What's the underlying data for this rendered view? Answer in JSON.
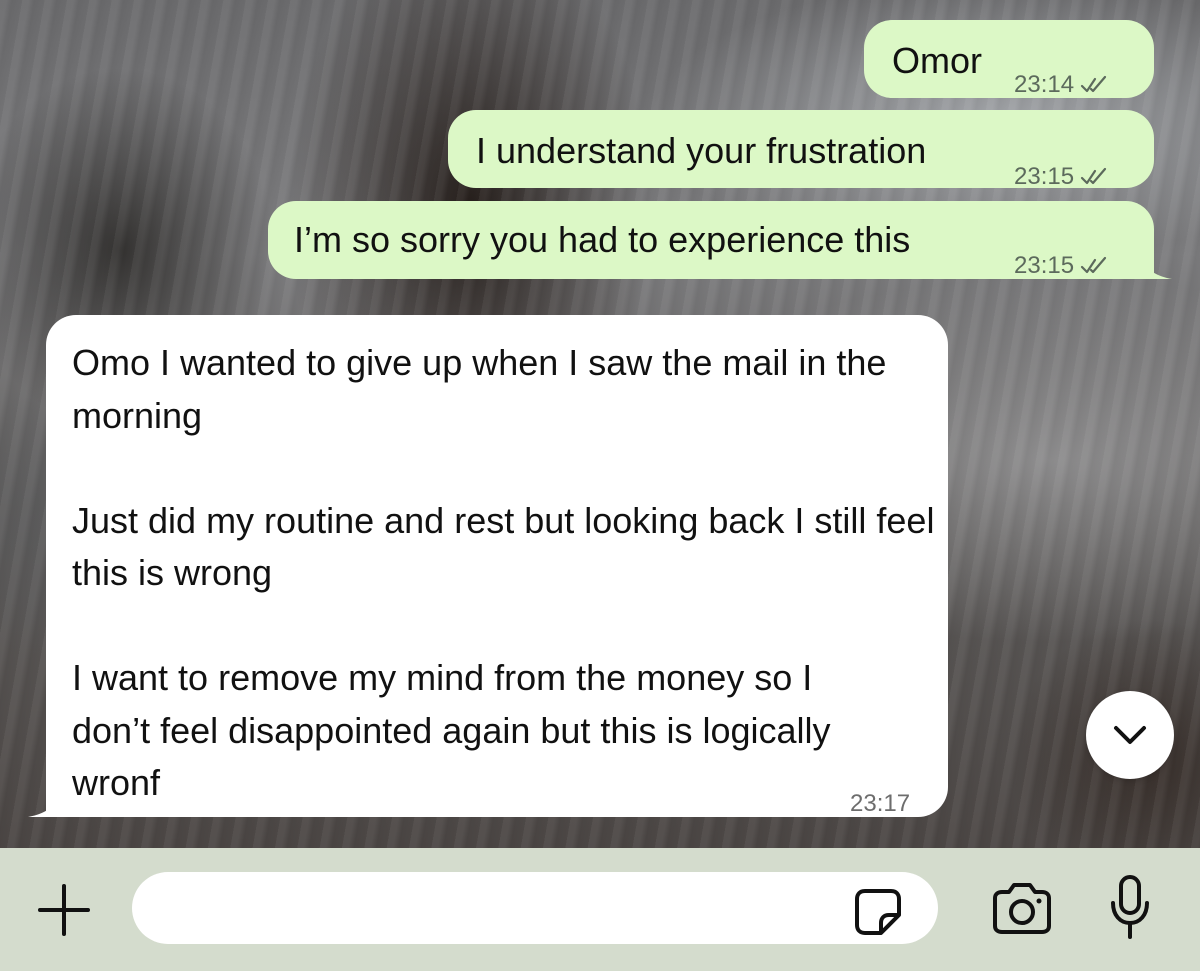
{
  "chat": {
    "messages": [
      {
        "direction": "outgoing",
        "text": "Omor",
        "time": "23:14",
        "status_icon": "double-check-icon"
      },
      {
        "direction": "outgoing",
        "text": "I understand your frustration",
        "time": "23:15",
        "status_icon": "double-check-icon"
      },
      {
        "direction": "outgoing",
        "text": "I’m so sorry you had to experience this",
        "time": "23:15",
        "status_icon": "double-check-icon"
      },
      {
        "direction": "incoming",
        "paragraphs": [
          "Omo I wanted to give up when I saw the mail in the morning",
          "Just did my routine and rest but looking back I still feel this is wrong",
          "I want to  remove my mind from the money so I don’t feel disappointed again but this is logically wronf"
        ],
        "time": "23:17"
      }
    ],
    "scroll_down_icon": "chevron-down-icon"
  },
  "input_bar": {
    "attach_icon": "plus-icon",
    "message_value": "",
    "message_placeholder": "",
    "sticker_icon": "sticker-icon",
    "camera_icon": "camera-icon",
    "mic_icon": "microphone-icon"
  },
  "colors": {
    "outgoing_bubble": "#dcf8c6",
    "incoming_bubble": "#ffffff",
    "input_bar_bg": "#d4dccd"
  }
}
